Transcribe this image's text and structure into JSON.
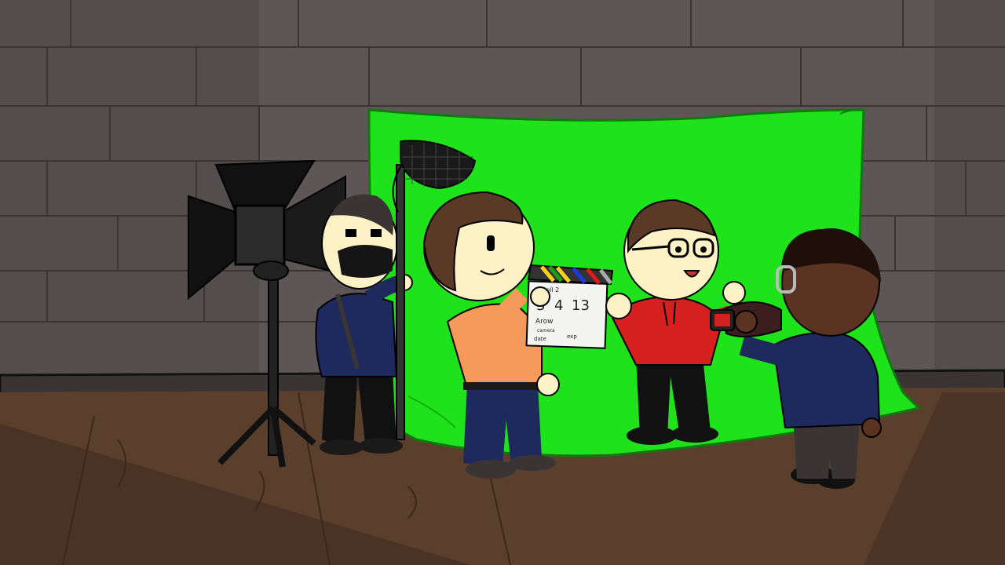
{
  "scene": {
    "description_free": true,
    "clapperboard": {
      "roll_label": "Roll 2",
      "scene_number": "3",
      "take_number": "4",
      "shot_number": "13",
      "production_label": "Arow",
      "camera_label": "camera",
      "date_label": "date",
      "extra_label": "exp"
    }
  },
  "colors": {
    "wall": "#5e5656",
    "wall_dark": "#4a4343",
    "floor": "#5a3f2c",
    "green_screen": "#1ee31a",
    "orange_shirt": "#f59a5a",
    "red_hoodie": "#d61f1f",
    "navy": "#1e2a5e",
    "skin": "#fdf1c6",
    "hair_brown": "#5a3a26",
    "dark_skin": "#5a3322"
  }
}
